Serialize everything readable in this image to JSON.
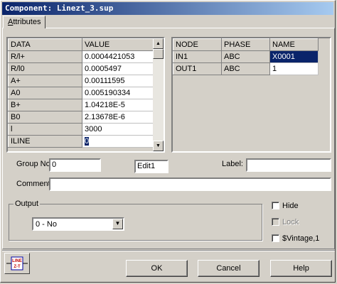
{
  "window": {
    "title": "Component: Linezt_3.sup"
  },
  "tab": {
    "label": "Attributes",
    "accel": "A",
    "rest": "ttributes"
  },
  "data_grid": {
    "columns": [
      "DATA",
      "VALUE"
    ],
    "rows": [
      {
        "data": "R/l+",
        "value": "0.0004421053"
      },
      {
        "data": "R/l0",
        "value": "0.0005497"
      },
      {
        "data": "A+",
        "value": "0.00111595"
      },
      {
        "data": "A0",
        "value": "0.005190334"
      },
      {
        "data": "B+",
        "value": "1.04218E-5"
      },
      {
        "data": "B0",
        "value": "2.13678E-6"
      },
      {
        "data": "l",
        "value": "3000"
      },
      {
        "data": "ILINE",
        "value": "0"
      }
    ]
  },
  "node_grid": {
    "columns": [
      "NODE",
      "PHASE",
      "NAME"
    ],
    "rows": [
      {
        "node": "IN1",
        "phase": "ABC",
        "name": "X0001"
      },
      {
        "node": "OUT1",
        "phase": "ABC",
        "name": "1"
      }
    ]
  },
  "group_no": {
    "label": "Group No:",
    "value": "0"
  },
  "edit1": {
    "value": "Edit1"
  },
  "label_field": {
    "label": "Label:",
    "value": ""
  },
  "comment": {
    "label": "Comment:",
    "value": ""
  },
  "output": {
    "label": "Output",
    "selected": "0 - No"
  },
  "checkboxes": {
    "hide": {
      "label": "Hide",
      "checked": false
    },
    "lock": {
      "label": "Lock",
      "checked": false,
      "disabled": true
    },
    "vintage": {
      "label": "$Vintage,1",
      "checked": false
    }
  },
  "buttons": {
    "ok": "OK",
    "cancel": "Cancel",
    "help": "Help"
  },
  "component_icon": {
    "text_top": "LINE",
    "text_bottom": "Z-T",
    "icon": "line-component-icon"
  },
  "colors": {
    "selection": "#0a246a",
    "face": "#d4d0c8",
    "title_start": "#0a246a",
    "title_end": "#a6caf0"
  }
}
